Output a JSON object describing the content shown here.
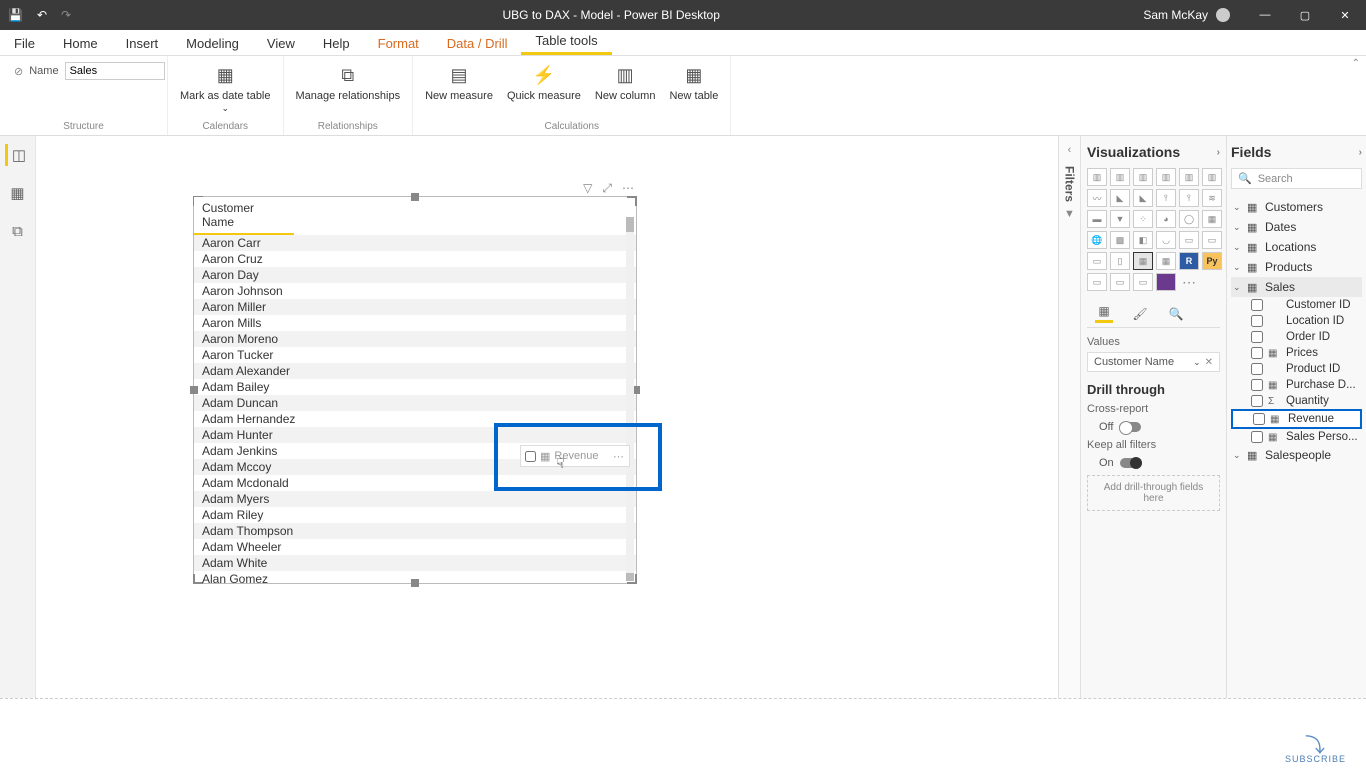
{
  "titlebar": {
    "title": "UBG to DAX - Model - Power BI Desktop",
    "user": "Sam McKay"
  },
  "menu": {
    "file": "File",
    "tabs": [
      "Home",
      "Insert",
      "Modeling",
      "View",
      "Help",
      "Format",
      "Data / Drill",
      "Table tools"
    ]
  },
  "ribbon": {
    "name_label": "Name",
    "name_value": "Sales",
    "groups": {
      "structure": "Structure",
      "calendars": "Calendars",
      "relationships": "Relationships",
      "calculations": "Calculations"
    },
    "buttons": {
      "mark_date": "Mark as date table",
      "manage_rel": "Manage relationships",
      "new_measure": "New measure",
      "quick_measure": "Quick measure",
      "new_column": "New column",
      "new_table": "New table"
    }
  },
  "table": {
    "header": "Customer Name",
    "rows": [
      "Aaron Carr",
      "Aaron Cruz",
      "Aaron Day",
      "Aaron Johnson",
      "Aaron Miller",
      "Aaron Mills",
      "Aaron Moreno",
      "Aaron Tucker",
      "Adam Alexander",
      "Adam Bailey",
      "Adam Duncan",
      "Adam Hernandez",
      "Adam Hunter",
      "Adam Jenkins",
      "Adam Mccoy",
      "Adam Mcdonald",
      "Adam Myers",
      "Adam Riley",
      "Adam Thompson",
      "Adam Wheeler",
      "Adam White",
      "Alan Gomez"
    ]
  },
  "drag": {
    "chip": "Revenue"
  },
  "viz": {
    "title": "Visualizations",
    "values_label": "Values",
    "value_field": "Customer Name",
    "drill_title": "Drill through",
    "cross_report": "Cross-report",
    "off": "Off",
    "keep_filters": "Keep all filters",
    "on": "On",
    "dropzone": "Add drill-through fields here"
  },
  "fields": {
    "title": "Fields",
    "search": "Search",
    "tables": [
      "Customers",
      "Dates",
      "Locations",
      "Products",
      "Sales",
      "Salespeople"
    ],
    "sales_fields": [
      "Customer ID",
      "Location ID",
      "Order ID",
      "Prices",
      "Product ID",
      "Purchase D...",
      "Quantity",
      "Revenue",
      "Sales Perso..."
    ]
  },
  "filters_label": "Filters",
  "subscribe": "SUBSCRIBE"
}
